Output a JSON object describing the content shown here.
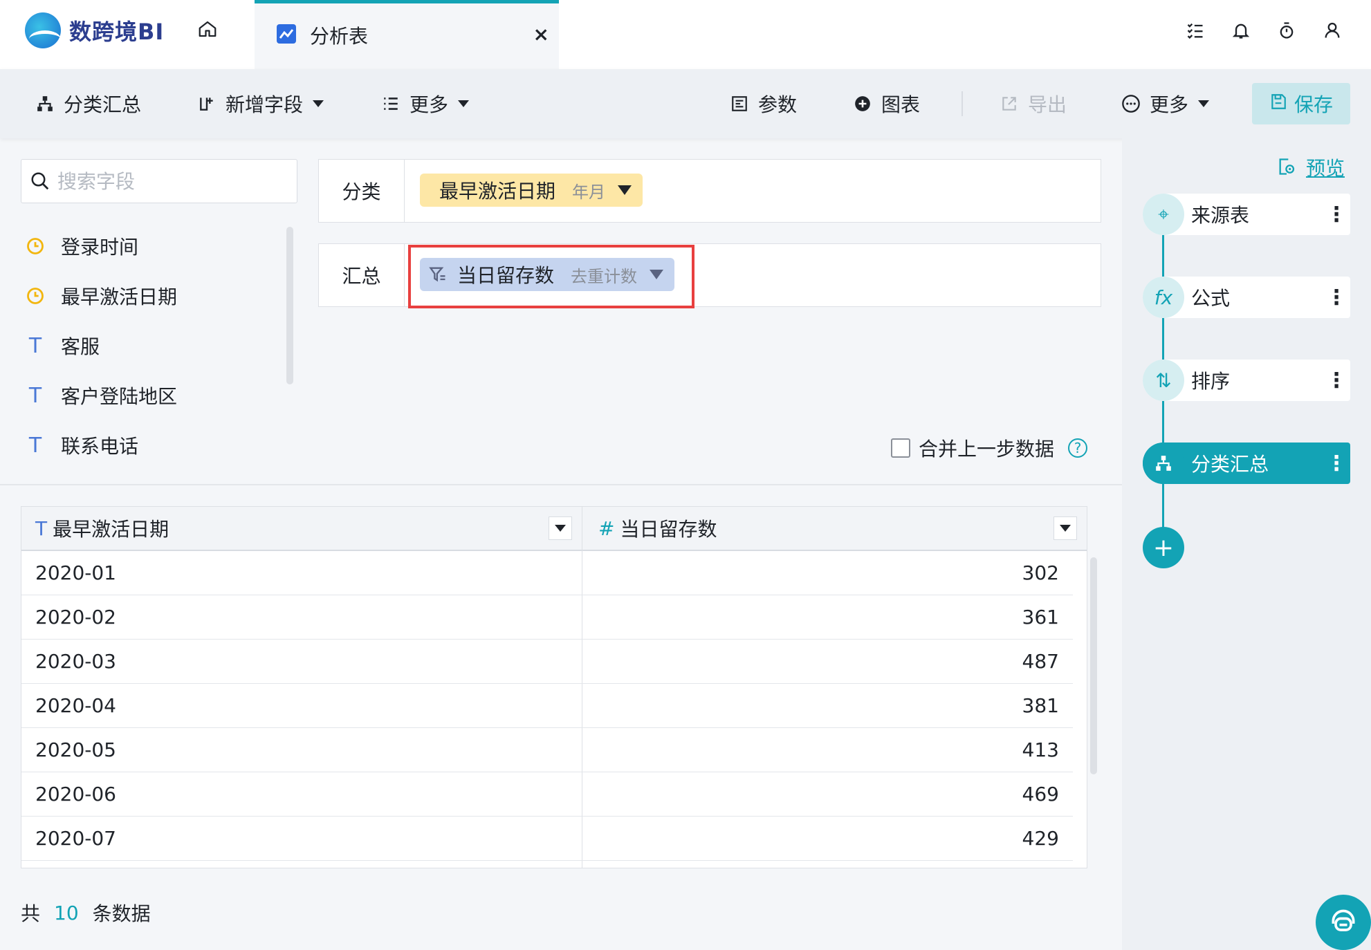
{
  "app": {
    "logo_text": "数跨境BI"
  },
  "tab": {
    "label": "分析表",
    "close_glyph": "×"
  },
  "topbar_icons": [
    "task-list-icon",
    "bell-icon",
    "timer-icon",
    "user-icon"
  ],
  "toolbar": {
    "group_summary": "分类汇总",
    "add_field": "新增字段",
    "more_left": "更多",
    "params": "参数",
    "chart": "图表",
    "export": "导出",
    "more_right": "更多",
    "save": "保存"
  },
  "fields": {
    "search_placeholder": "搜索字段",
    "items": [
      {
        "label": "登录时间",
        "type": "date"
      },
      {
        "label": "最早激活日期",
        "type": "date"
      },
      {
        "label": "客服",
        "type": "text"
      },
      {
        "label": "客户登陆地区",
        "type": "text"
      },
      {
        "label": "联系电话",
        "type": "text"
      }
    ]
  },
  "config": {
    "group_label": "分类",
    "group_field": {
      "name": "最早激活日期",
      "granularity": "年月"
    },
    "summary_label": "汇总",
    "summary_field": {
      "name": "当日留存数",
      "agg": "去重计数"
    },
    "merge_label": "合并上一步数据",
    "help_glyph": "?"
  },
  "table": {
    "columns": [
      {
        "label": "最早激活日期",
        "type_glyph": "T"
      },
      {
        "label": "当日留存数",
        "type_glyph": "#"
      }
    ],
    "rows": [
      {
        "date": "2020-01",
        "value": "302"
      },
      {
        "date": "2020-02",
        "value": "361"
      },
      {
        "date": "2020-03",
        "value": "487"
      },
      {
        "date": "2020-04",
        "value": "381"
      },
      {
        "date": "2020-05",
        "value": "413"
      },
      {
        "date": "2020-06",
        "value": "469"
      },
      {
        "date": "2020-07",
        "value": "429"
      }
    ]
  },
  "footer": {
    "prefix": "共",
    "count": "10",
    "suffix": "条数据"
  },
  "steps": {
    "preview": "预览",
    "items": [
      {
        "label": "来源表",
        "icon": "target-icon",
        "badge": "⌖"
      },
      {
        "label": "公式",
        "icon": "fx-icon",
        "badge": "fx"
      },
      {
        "label": "排序",
        "icon": "sort-icon",
        "badge": "⇅"
      },
      {
        "label": "分类汇总",
        "icon": "group-summary-icon",
        "badge": "品",
        "active": true
      }
    ],
    "add_glyph": "+",
    "more_glyph": "⋮"
  },
  "colors": {
    "accent": "#13a3b5",
    "highlight": "#e8403f",
    "pill_yellow": "#fde7a6",
    "pill_blue": "#c5d4ef"
  }
}
